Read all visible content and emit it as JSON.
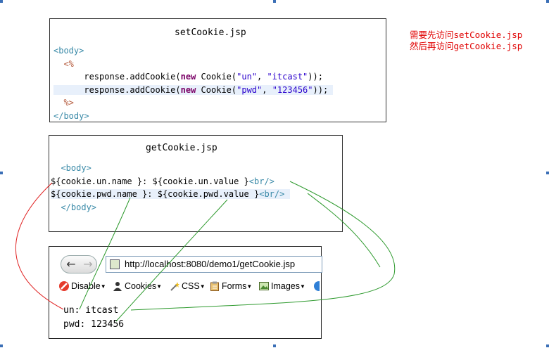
{
  "note": {
    "line1": "需要先访问setCookie.jsp",
    "line2": "然后再访问getCookie.jsp"
  },
  "setCookie": {
    "title": "setCookie.jsp",
    "body_open": "<body>",
    "jsp_open": "<%",
    "line1": {
      "call": "response.addCookie(",
      "kw": "new",
      "ctor": " Cookie(",
      "s1": "\"un\"",
      "sep": ", ",
      "s2": "\"itcast\"",
      "end": "));"
    },
    "line2": {
      "call": "response.addCookie(",
      "kw": "new",
      "ctor": " Cookie(",
      "s1": "\"pwd\"",
      "sep": ", ",
      "s2": "\"123456\"",
      "end": "));"
    },
    "jsp_close": "%>",
    "body_close": "</body>"
  },
  "getCookie": {
    "title": "getCookie.jsp",
    "body_open": "<body>",
    "line1": {
      "expr": "${cookie.un.name }: ${cookie.un.value }",
      "br": "<br/>"
    },
    "line2": {
      "expr": "${cookie.pwd.name }: ${cookie.pwd.value }",
      "br": "<br/>"
    },
    "body_close": "</body>"
  },
  "browser": {
    "back_icon": "back-arrow-icon",
    "forward_icon": "forward-arrow-icon",
    "url": "http://localhost:8080/demo1/getCookie.jsp",
    "toolbar": {
      "disable": "Disable",
      "cookies": "Cookies",
      "css": "CSS",
      "forms": "Forms",
      "images": "Images"
    },
    "output": {
      "line1": "un: itcast",
      "line2": "pwd: 123456"
    }
  },
  "colors": {
    "note": "#e00000",
    "tag": "#3a8aa8",
    "connector_green": "#2e9a2e",
    "connector_red": "#e02020"
  }
}
